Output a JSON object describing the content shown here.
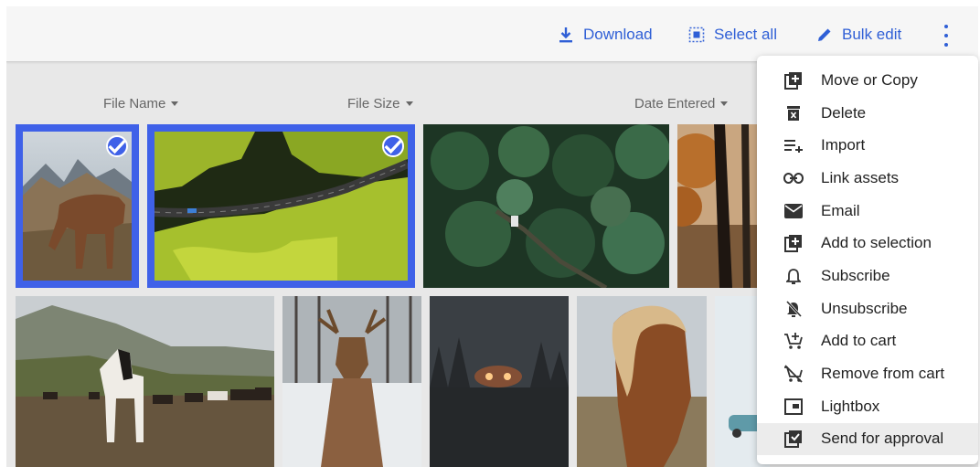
{
  "toolbar": {
    "download_label": "Download",
    "select_all_label": "Select all",
    "bulk_edit_label": "Bulk edit"
  },
  "sort": {
    "file_name": "File Name",
    "file_size": "File Size",
    "date_entered": "Date Entered"
  },
  "colors": {
    "accent": "#2f5fd6",
    "selection_border": "#3f61e8",
    "menu_active_bg": "#ececec"
  },
  "menu": {
    "items": [
      {
        "label": "Move or Copy",
        "icon": "move-copy-icon"
      },
      {
        "label": "Delete",
        "icon": "trash-icon"
      },
      {
        "label": "Import",
        "icon": "import-list-icon"
      },
      {
        "label": "Link assets",
        "icon": "link-icon"
      },
      {
        "label": "Email",
        "icon": "envelope-icon"
      },
      {
        "label": "Add to selection",
        "icon": "add-box-icon"
      },
      {
        "label": "Subscribe",
        "icon": "bell-icon"
      },
      {
        "label": "Unsubscribe",
        "icon": "bell-off-icon"
      },
      {
        "label": "Add to cart",
        "icon": "cart-add-icon"
      },
      {
        "label": "Remove from cart",
        "icon": "cart-remove-icon"
      },
      {
        "label": "Lightbox",
        "icon": "lightbox-icon"
      },
      {
        "label": "Send for approval",
        "icon": "approval-check-icon"
      }
    ]
  },
  "grid": {
    "row1": [
      {
        "subject": "horse grazing by mountains",
        "selected": true
      },
      {
        "subject": "aerial road through green moss",
        "selected": true
      },
      {
        "subject": "aerial pine forest with car",
        "selected": false
      },
      {
        "subject": "autumn tree silhouette",
        "selected": false
      }
    ],
    "row2": [
      {
        "subject": "herd of horses in valley",
        "selected": false
      },
      {
        "subject": "deer in snowy forest",
        "selected": false
      },
      {
        "subject": "car headlights on foggy road",
        "selected": false
      },
      {
        "subject": "horse with blond mane",
        "selected": false
      },
      {
        "subject": "blue car in snow",
        "selected": false
      }
    ]
  }
}
